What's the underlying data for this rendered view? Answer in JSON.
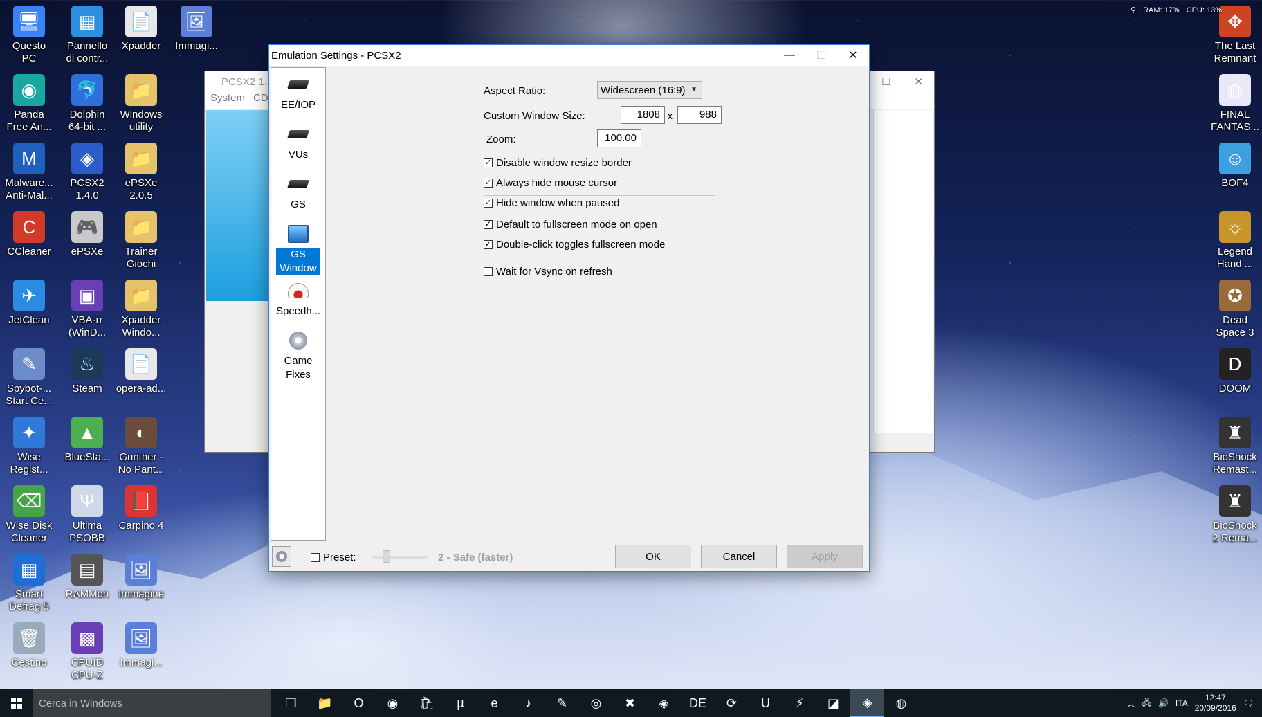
{
  "desktop": {
    "left_icons": [
      {
        "name": "questo-pc",
        "label": "Questo\nPC",
        "glyph": "🖥",
        "color": "#3b82f6"
      },
      {
        "name": "pannello",
        "label": "Pannello\ndi contr...",
        "glyph": "▦",
        "color": "#2d8fe0"
      },
      {
        "name": "xpadder",
        "label": "Xpadder",
        "glyph": "📄",
        "color": "#e8e8e8"
      },
      {
        "name": "immagine-1",
        "label": "Immagi...",
        "glyph": "🖼",
        "color": "#5b7fd6"
      },
      {
        "name": "panda",
        "label": "Panda\nFree An...",
        "glyph": "◉",
        "color": "#1aa7a0"
      },
      {
        "name": "dolphin",
        "label": "Dolphin\n64-bit ...",
        "glyph": "🐬",
        "color": "#2f6fdc"
      },
      {
        "name": "windows-utility",
        "label": "Windows\nutility",
        "glyph": "📁",
        "color": "#e6c36a"
      },
      {
        "name": "malwarebytes",
        "label": "Malware...\nAnti-Mal...",
        "glyph": "M",
        "color": "#1f5fbf"
      },
      {
        "name": "pcsx2",
        "label": "PCSX2\n1.4.0",
        "glyph": "◈",
        "color": "#2b5cc9"
      },
      {
        "name": "epsxe-folder",
        "label": "ePSXe\n2.0.5",
        "glyph": "📁",
        "color": "#e6c36a"
      },
      {
        "name": "ccleaner",
        "label": "CCleaner",
        "glyph": "C",
        "color": "#d23a2a"
      },
      {
        "name": "epsxe",
        "label": "ePSXe",
        "glyph": "🎮",
        "color": "#c9c9c9"
      },
      {
        "name": "trainer-giochi",
        "label": "Trainer\nGiochi",
        "glyph": "📁",
        "color": "#e6c36a"
      },
      {
        "name": "jetclean",
        "label": "JetClean",
        "glyph": "✈",
        "color": "#2a8be0"
      },
      {
        "name": "vba-rr",
        "label": "VBA-rr\n(WinD...",
        "glyph": "▣",
        "color": "#6a3fb5"
      },
      {
        "name": "xpadder-windows",
        "label": "Xpadder\nWindo...",
        "glyph": "📁",
        "color": "#e6c36a"
      },
      {
        "name": "spybot",
        "label": "Spybot-...\nStart Ce...",
        "glyph": "✎",
        "color": "#6b8cc9"
      },
      {
        "name": "steam",
        "label": "Steam",
        "glyph": "♨",
        "color": "#1b3a5a"
      },
      {
        "name": "opera-ad",
        "label": "opera-ad...",
        "glyph": "📄",
        "color": "#e8e8e8"
      },
      {
        "name": "wise-registry",
        "label": "Wise\nRegist...",
        "glyph": "✦",
        "color": "#2f7ad9"
      },
      {
        "name": "bluestacks",
        "label": "BlueSta...",
        "glyph": "▲",
        "color": "#4caf50"
      },
      {
        "name": "gunther",
        "label": "Gunther -\nNo Pant...",
        "glyph": "◐",
        "color": "#6b4b3b"
      },
      {
        "name": "wise-disk",
        "label": "Wise Disk\nCleaner",
        "glyph": "⌫",
        "color": "#47a447"
      },
      {
        "name": "ultima-psobb",
        "label": "Ultima\nPSOBB",
        "glyph": "Ψ",
        "color": "#cfd8e6"
      },
      {
        "name": "carpino",
        "label": "Carpino 4",
        "glyph": "📕",
        "color": "#d33"
      },
      {
        "name": "smart-defrag",
        "label": "Smart\nDefrag 5",
        "glyph": "▦",
        "color": "#1f6ed4"
      },
      {
        "name": "rammon",
        "label": "RAMMon",
        "glyph": "▤",
        "color": "#555"
      },
      {
        "name": "immagine-2",
        "label": "Immagine",
        "glyph": "🖼",
        "color": "#5b7fd6"
      },
      {
        "name": "cestino",
        "label": "Cestino",
        "glyph": "🗑",
        "color": "#9ab"
      },
      {
        "name": "cpuid",
        "label": "CPUID\nCPU-Z",
        "glyph": "▩",
        "color": "#6a3fb5"
      },
      {
        "name": "immagine-3",
        "label": "Immagi...",
        "glyph": "🖼",
        "color": "#5b7fd6"
      }
    ],
    "right_icons": [
      {
        "name": "the-last-remnant",
        "label": "The Last\nRemnant",
        "glyph": "✥",
        "color": "#c42"
      },
      {
        "name": "final-fantasy",
        "label": "FINAL\nFANTAS...",
        "glyph": "◍",
        "color": "#e8e8f8"
      },
      {
        "name": "bof4",
        "label": "BOF4",
        "glyph": "☺",
        "color": "#3aa0e0"
      },
      {
        "name": "legend-hand",
        "label": "Legend\nHand ...",
        "glyph": "☼",
        "color": "#c8952a"
      },
      {
        "name": "dead-space-3",
        "label": "Dead\nSpace 3",
        "glyph": "✪",
        "color": "#9a6a3a"
      },
      {
        "name": "doom",
        "label": "DOOM",
        "glyph": "D",
        "color": "#222"
      },
      {
        "name": "bioshock-remastered",
        "label": "BioShock\nRemast...",
        "glyph": "♜",
        "color": "#333"
      },
      {
        "name": "bioshock-2-remastered",
        "label": "BioShock\n2 Rema...",
        "glyph": "♜",
        "color": "#333"
      }
    ]
  },
  "tray_stats": {
    "ram": "RAM: 17%",
    "cpu": "CPU: 13%"
  },
  "bg_window": {
    "title": "PCSX2  1.",
    "menu": [
      "System",
      "CD"
    ]
  },
  "dialog": {
    "title": "Emulation Settings - PCSX2",
    "sidebar": [
      {
        "name": "eeiop",
        "label": "EE/IOP",
        "icon": "chip",
        "selected": false
      },
      {
        "name": "vus",
        "label": "VUs",
        "icon": "chip",
        "selected": false
      },
      {
        "name": "gs",
        "label": "GS",
        "icon": "chip",
        "selected": false
      },
      {
        "name": "gs-window",
        "label": "GS\nWindow",
        "icon": "monitor",
        "selected": true
      },
      {
        "name": "speedhacks",
        "label": "Speedh...",
        "icon": "speedo",
        "selected": false
      },
      {
        "name": "game-fixes",
        "label": "Game\nFixes",
        "icon": "disc",
        "selected": false
      }
    ],
    "aspect_ratio": {
      "label": "Aspect Ratio:",
      "value": "Widescreen (16:9)"
    },
    "custom_size": {
      "label": "Custom Window Size:",
      "width": "1808",
      "x": "x",
      "height": "988"
    },
    "zoom": {
      "label": "Zoom:",
      "value": "100.00"
    },
    "checks": [
      {
        "name": "disable-resize-border",
        "label": "Disable window resize border",
        "checked": true
      },
      {
        "name": "hide-mouse-cursor",
        "label": "Always hide mouse cursor",
        "checked": true
      },
      {
        "name": "hide-when-paused",
        "label": "Hide window when paused",
        "checked": true
      },
      {
        "name": "default-fullscreen",
        "label": "Default to fullscreen mode on open",
        "checked": true
      },
      {
        "name": "doubleclick-fullscreen",
        "label": "Double-click toggles fullscreen mode",
        "checked": true
      },
      {
        "name": "wait-vsync",
        "label": "Wait for Vsync on refresh",
        "checked": false
      }
    ],
    "preset": {
      "label": "Preset:",
      "value": "2 - Safe (faster)",
      "level": 2
    },
    "buttons": {
      "ok": "OK",
      "cancel": "Cancel",
      "apply": "Apply"
    }
  },
  "taskbar": {
    "search_placeholder": "Cerca in Windows",
    "apps": [
      {
        "name": "task-view",
        "glyph": "❐"
      },
      {
        "name": "file-explorer",
        "glyph": "📁"
      },
      {
        "name": "opera",
        "glyph": "O"
      },
      {
        "name": "chrome",
        "glyph": "◉"
      },
      {
        "name": "store",
        "glyph": "🛍"
      },
      {
        "name": "utorrent",
        "glyph": "µ"
      },
      {
        "name": "edge-ie",
        "glyph": "e"
      },
      {
        "name": "itunes",
        "glyph": "♪"
      },
      {
        "name": "notes",
        "glyph": "✎"
      },
      {
        "name": "app-circle",
        "glyph": "◎"
      },
      {
        "name": "app-x",
        "glyph": "✖"
      },
      {
        "name": "app-red",
        "glyph": "◈"
      },
      {
        "name": "app-de",
        "glyph": "DE"
      },
      {
        "name": "app-refresh",
        "glyph": "⟳"
      },
      {
        "name": "app-u",
        "glyph": "U"
      },
      {
        "name": "app-flash",
        "glyph": "⚡"
      },
      {
        "name": "app-graph",
        "glyph": "◪"
      },
      {
        "name": "pcsx2-active",
        "glyph": "◈",
        "active": true
      },
      {
        "name": "app-disc",
        "glyph": "◍"
      }
    ],
    "language": "ITA",
    "time": "12:47",
    "date": "20/09/2016"
  }
}
